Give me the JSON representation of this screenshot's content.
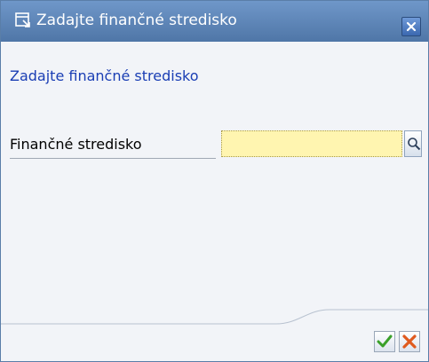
{
  "dialog": {
    "title": "Zadajte finančné stredisko",
    "subtitle": "Zadajte finančné stredisko"
  },
  "field": {
    "label": "Finančné stredisko",
    "value": ""
  },
  "icons": {
    "title": "dialog-window-icon",
    "close": "close-icon",
    "search": "search-icon",
    "ok": "checkmark-icon",
    "cancel": "cancel-icon"
  },
  "colors": {
    "titlebar": "#5b83b6",
    "subtitle_text": "#1a3eb4",
    "input_background": "#fff5b0",
    "ok_green": "#3aa02a",
    "cancel_red": "#e05a1e"
  }
}
